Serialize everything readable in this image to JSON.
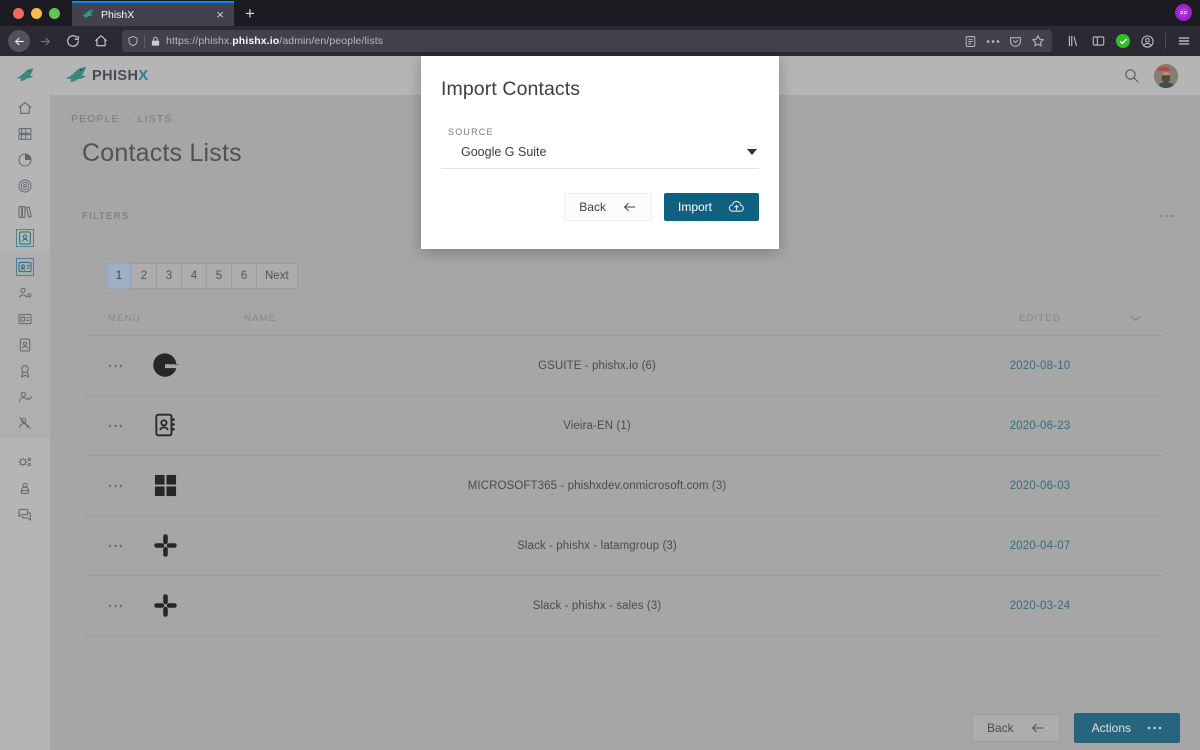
{
  "browser": {
    "tab": {
      "title": "PhishX",
      "favicon_icon": "phishx-fish-icon",
      "close_icon": "close-icon"
    },
    "newtab_icon": "plus-icon",
    "extension_badge_icon": "extension-badge-icon",
    "nav": {
      "back_icon": "back-arrow-icon",
      "forward_icon": "forward-arrow-icon",
      "reload_icon": "reload-icon",
      "home_icon": "home-icon"
    },
    "url": {
      "shield_icon": "shield-icon",
      "lock_icon": "lock-icon",
      "prefix": "https://phishx.",
      "domain": "phishx.io",
      "path": "/admin/en/people/lists",
      "reader_icon": "reader-mode-icon",
      "page_actions_icon": "page-actions-ellipsis-icon",
      "pocket_icon": "pocket-icon",
      "bookmark_icon": "star-bookmark-icon"
    },
    "toolbar_right": {
      "library_icon": "library-icon",
      "sidebar_icon": "sidebar-icon",
      "status_check_icon": "green-check-icon",
      "account_icon": "account-avatar-icon",
      "menu_icon": "hamburger-menu-icon"
    }
  },
  "sidebar": {
    "logo_icon": "phishx-fish-icon",
    "items": [
      {
        "name": "home",
        "icon": "home-icon",
        "active": false
      },
      {
        "name": "dashboard",
        "icon": "grid-server-icon",
        "active": false
      },
      {
        "name": "reports",
        "icon": "pie-chart-icon",
        "active": false
      },
      {
        "name": "campaigns",
        "icon": "target-icon",
        "active": false
      },
      {
        "name": "library",
        "icon": "books-icon",
        "active": false
      },
      {
        "name": "people",
        "icon": "contact-card-icon",
        "active": true
      }
    ],
    "group_items": [
      {
        "name": "lists",
        "icon": "contact-list-icon",
        "active": true
      },
      {
        "name": "users",
        "icon": "user-settings-icon",
        "active": false
      },
      {
        "name": "id-cards",
        "icon": "id-card-icon",
        "active": false
      },
      {
        "name": "badges",
        "icon": "badge-portrait-icon",
        "active": false
      },
      {
        "name": "awards",
        "icon": "award-medal-icon",
        "active": false
      },
      {
        "name": "approved-users",
        "icon": "user-check-icon",
        "active": false
      },
      {
        "name": "blocked-users",
        "icon": "user-blocked-icon",
        "active": false
      }
    ],
    "footer_items": [
      {
        "name": "integrations",
        "icon": "gear-network-icon",
        "active": false
      },
      {
        "name": "account",
        "icon": "user-box-icon",
        "active": false
      },
      {
        "name": "support-chat",
        "icon": "chat-bubbles-icon",
        "active": false
      }
    ]
  },
  "topbar": {
    "brand_main": "PHISH",
    "brand_accent": "X",
    "logo_icon": "phishx-fish-icon",
    "search_icon": "search-icon",
    "avatar_icon": "user-avatar"
  },
  "breadcrumb": {
    "parent": "PEOPLE",
    "separator": "›",
    "current": "LISTS"
  },
  "page": {
    "title": "Contacts Lists",
    "filters_label": "FILTERS",
    "filters_more_icon": "ellipsis-icon"
  },
  "pagination": {
    "pages": [
      "1",
      "2",
      "3",
      "4",
      "5",
      "6"
    ],
    "next_label": "Next",
    "active_page": "1"
  },
  "table": {
    "columns": {
      "menu": "MENU",
      "name": "NAME",
      "edited": "EDITED"
    },
    "sort_icon": "chevron-down-icon",
    "row_menu_icon": "ellipsis-icon",
    "rows": [
      {
        "icon": "google-g-icon",
        "name": "GSUITE - phishx.io (6)",
        "edited": "2020-08-10"
      },
      {
        "icon": "contact-book-icon",
        "name": "Vieira-EN (1)",
        "edited": "2020-06-23"
      },
      {
        "icon": "microsoft-icon",
        "name": "MICROSOFT365 - phishxdev.onmicrosoft.com (3)",
        "edited": "2020-06-03"
      },
      {
        "icon": "slack-icon",
        "name": "Slack - phishx - latamgroup (3)",
        "edited": "2020-04-07"
      },
      {
        "icon": "slack-icon",
        "name": "Slack - phishx - sales (3)",
        "edited": "2020-03-24"
      }
    ]
  },
  "bottombar": {
    "back_label": "Back",
    "back_icon": "arrow-left-icon",
    "actions_label": "Actions",
    "actions_icon": "ellipsis-icon"
  },
  "modal": {
    "title": "Import Contacts",
    "source_label": "SOURCE",
    "source_value": "Google G Suite",
    "caret_icon": "caret-down-icon",
    "back_label": "Back",
    "back_icon": "arrow-left-icon",
    "import_label": "Import",
    "import_icon": "cloud-upload-icon"
  },
  "colors": {
    "accent_teal": "#10607f",
    "link_teal": "#1f6b80",
    "app_bg": "#b4b4b4",
    "sidebar_bg": "#c7c7c7",
    "pager_active": "#a9bed9"
  }
}
